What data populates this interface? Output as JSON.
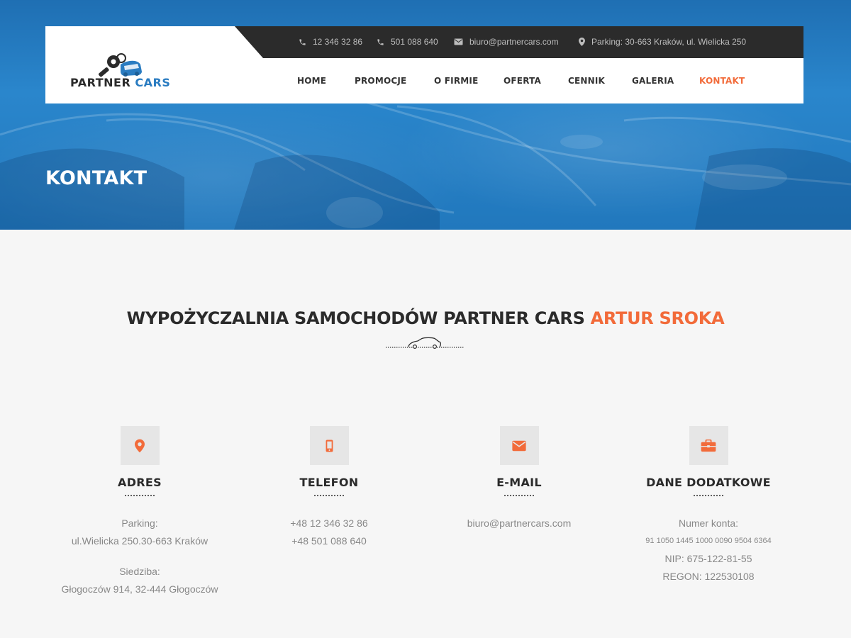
{
  "header": {
    "logo": {
      "word1": "PARTNER",
      "word2": "CARS"
    },
    "topbar": {
      "phone1": "12 346 32 86",
      "phone2": "501 088 640",
      "email": "biuro@partnercars.com",
      "address": "Parking: 30-663 Kraków, ul. Wielicka 250"
    },
    "nav": [
      {
        "label": "HOME"
      },
      {
        "label": "PROMOCJE"
      },
      {
        "label": "O FIRMIE"
      },
      {
        "label": "OFERTA"
      },
      {
        "label": "CENNIK"
      },
      {
        "label": "GALERIA"
      },
      {
        "label": "KONTAKT",
        "active": true
      }
    ]
  },
  "hero": {
    "title": "KONTAKT"
  },
  "section": {
    "title_main": "WYPOŻYCZALNIA SAMOCHODÓW PARTNER CARS",
    "title_accent": "ARTUR SROKA"
  },
  "cards": [
    {
      "icon": "map-pin-icon",
      "title": "ADRES",
      "lines": [
        "Parking:",
        "ul.Wielicka 250.30-663 Kraków",
        "",
        "Siedziba:",
        "Głogoczów 914, 32-444 Głogoczów"
      ]
    },
    {
      "icon": "mobile-phone-icon",
      "title": "TELEFON",
      "lines": [
        "+48 12 346 32 86",
        "+48 501 088 640"
      ]
    },
    {
      "icon": "envelope-icon",
      "title": "E-MAIL",
      "lines": [
        "biuro@partnercars.com"
      ]
    },
    {
      "icon": "briefcase-icon",
      "title": "DANE DODATKOWE",
      "lines": [
        "Numer konta:",
        "91 1050 1445 1000 0090 9504 6364",
        "NIP: 675-122-81-55",
        "REGON: 122530108"
      ]
    }
  ],
  "colors": {
    "accent": "#f26b3a",
    "brand_blue": "#2a7cc1",
    "topbar_bg": "#2b2b2b",
    "hero_blue": "#2178bd"
  }
}
